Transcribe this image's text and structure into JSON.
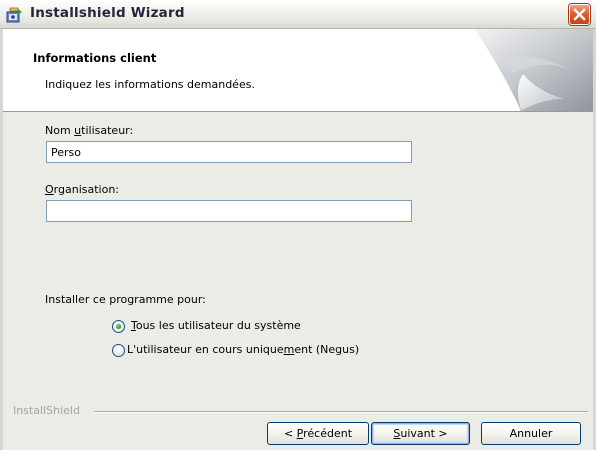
{
  "window": {
    "title": "Installshield Wizard"
  },
  "header": {
    "title": "Informations client",
    "subtitle": "Indiquez les informations demandées."
  },
  "form": {
    "username": {
      "label_pre": "Nom ",
      "label_accel": "u",
      "label_post": "tilisateur:",
      "value": "Perso"
    },
    "organization": {
      "label_accel": "O",
      "label_post": "rganisation:",
      "value": ""
    }
  },
  "install_for": {
    "label": "Installer ce programme pour:",
    "options": [
      {
        "accel": "T",
        "text": "ous les utilisateur du système",
        "selected": true
      },
      {
        "pre": "L'utilisateur en cours unique",
        "accel": "m",
        "post": "ent (Negus)",
        "selected": false
      }
    ]
  },
  "footer": {
    "brand": "InstallShield",
    "back": {
      "pre": "< ",
      "accel": "P",
      "post": "récédent"
    },
    "next": {
      "accel": "S",
      "post": "uivant >"
    },
    "cancel": "Annuler"
  },
  "icons": {
    "app": "installer-icon",
    "close": "close-icon"
  }
}
